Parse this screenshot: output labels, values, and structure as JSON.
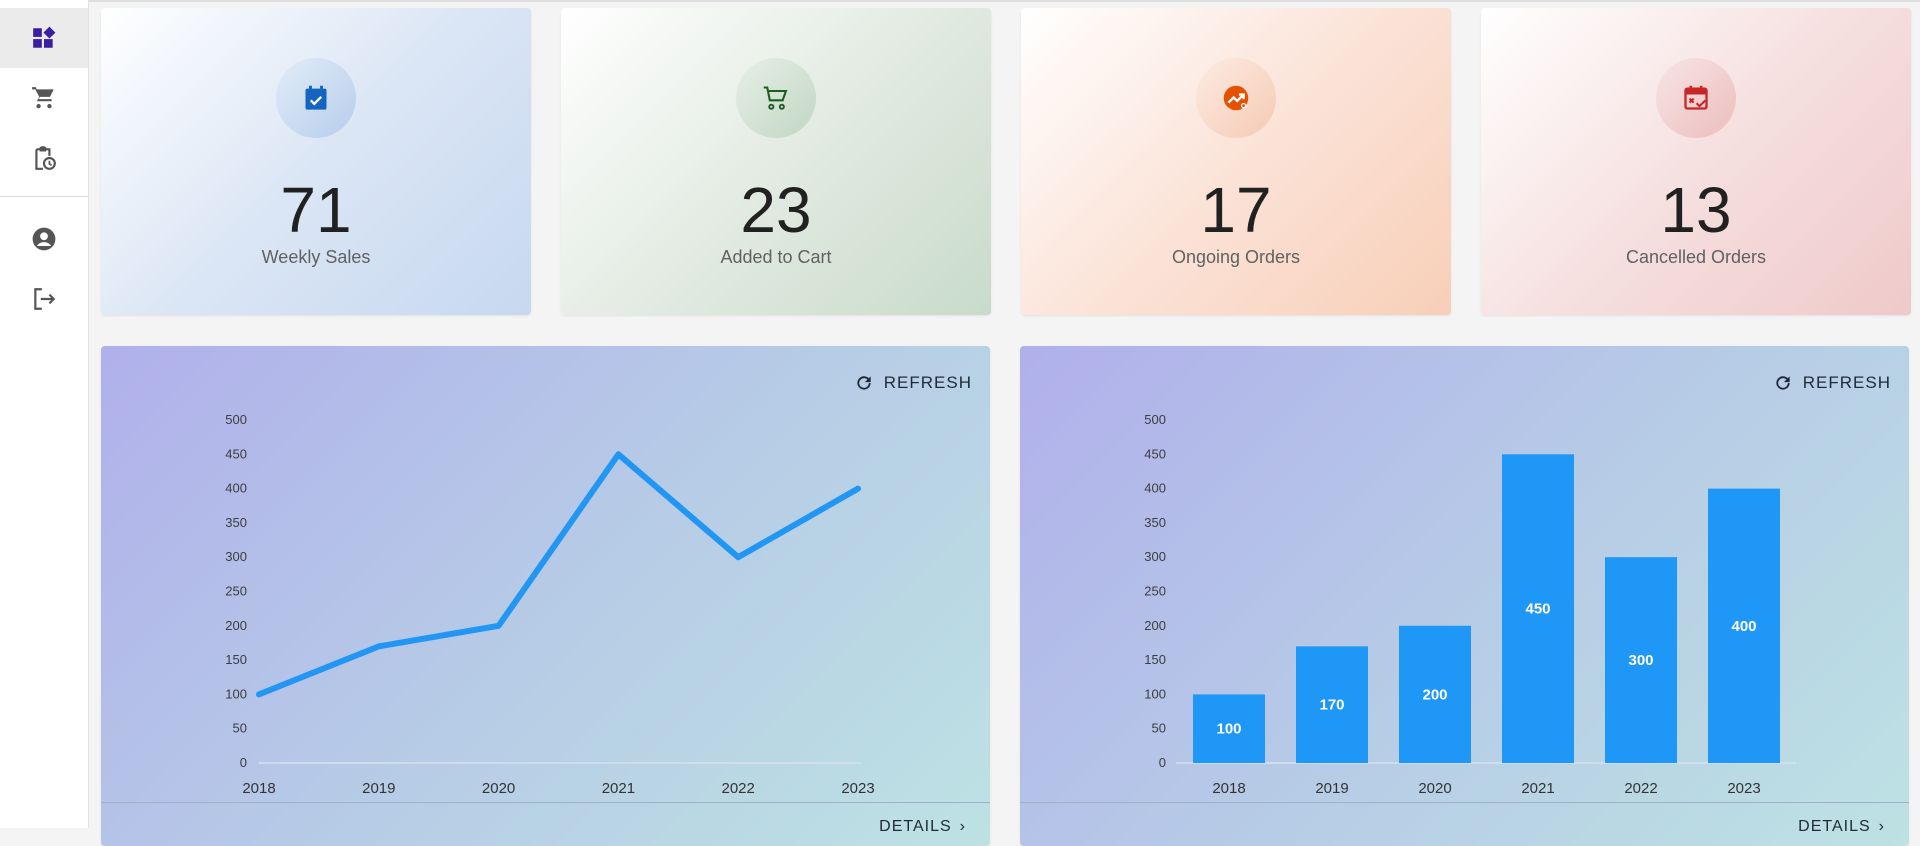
{
  "sidebar": {
    "items": [
      {
        "icon": "dashboard-icon",
        "active": true
      },
      {
        "icon": "cart-icon",
        "active": false
      },
      {
        "icon": "clipboard-clock-icon",
        "active": false
      },
      {
        "icon": "account-icon",
        "active": false
      },
      {
        "icon": "logout-icon",
        "active": false
      }
    ]
  },
  "stats": [
    {
      "value": "71",
      "label": "Weekly Sales",
      "icon": "calendar-check-icon",
      "accent": "#1565c0"
    },
    {
      "value": "23",
      "label": "Added to Cart",
      "icon": "cart-outline-icon",
      "accent": "#1b5e20"
    },
    {
      "value": "17",
      "label": "Ongoing Orders",
      "icon": "trending-up-icon",
      "accent": "#e65100"
    },
    {
      "value": "13",
      "label": "Cancelled Orders",
      "icon": "calendar-cancel-icon",
      "accent": "#c62828"
    }
  ],
  "charts": {
    "refresh_label": "REFRESH",
    "details_label": "DETAILS"
  },
  "chart_data": [
    {
      "type": "line",
      "categories": [
        "2018",
        "2019",
        "2020",
        "2021",
        "2022",
        "2023"
      ],
      "values": [
        100,
        170,
        200,
        450,
        300,
        400
      ],
      "ylim": [
        0,
        500
      ],
      "yticks": [
        0,
        50,
        100,
        150,
        200,
        250,
        300,
        350,
        400,
        450,
        500
      ],
      "color": "#2196f3",
      "grid": false
    },
    {
      "type": "bar",
      "categories": [
        "2018",
        "2019",
        "2020",
        "2021",
        "2022",
        "2023"
      ],
      "values": [
        100,
        170,
        200,
        450,
        300,
        400
      ],
      "data_labels": true,
      "ylim": [
        0,
        500
      ],
      "yticks": [
        0,
        50,
        100,
        150,
        200,
        250,
        300,
        350,
        400,
        450,
        500
      ],
      "color": "#1e97f7",
      "grid": false
    }
  ]
}
